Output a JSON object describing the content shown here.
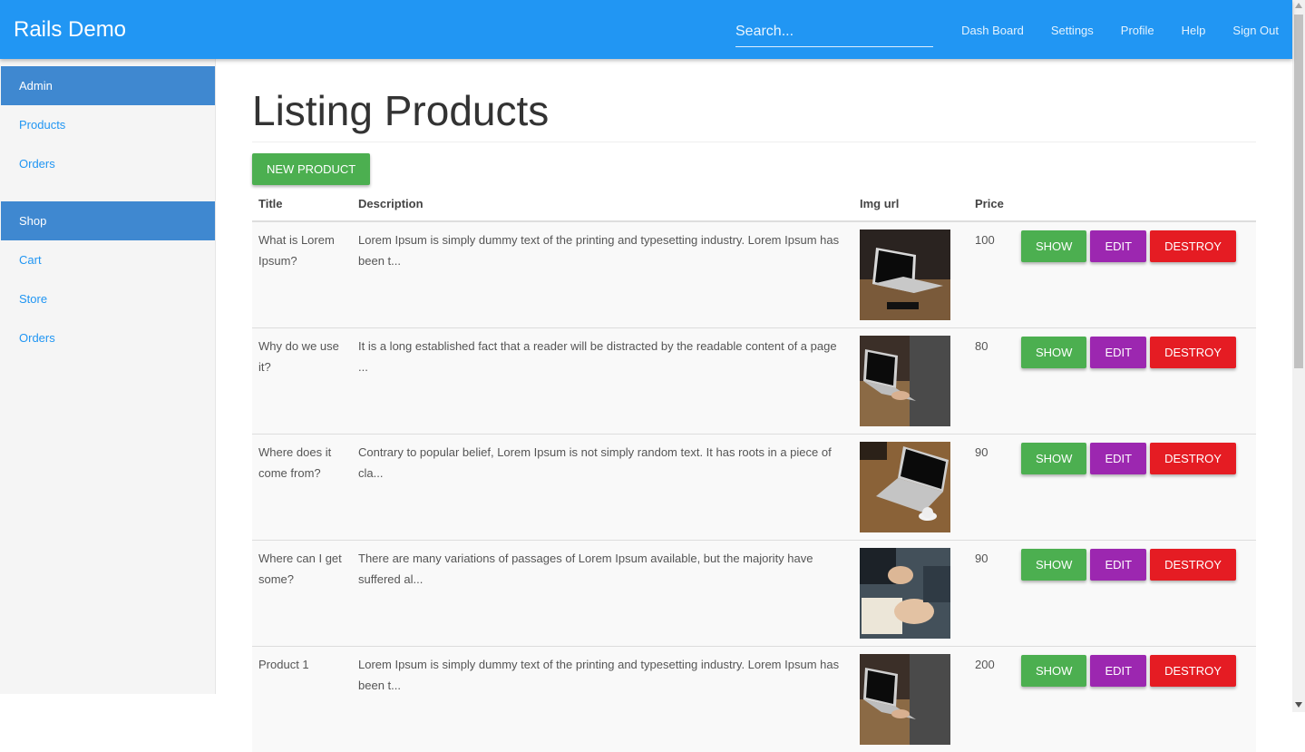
{
  "app": {
    "brand": "Rails Demo"
  },
  "search": {
    "placeholder": "Search..."
  },
  "nav": [
    "Dash Board",
    "Settings",
    "Profile",
    "Help",
    "Sign Out"
  ],
  "sidebar": {
    "admin_heading": "Admin",
    "admin_items": [
      "Products",
      "Orders"
    ],
    "shop_heading": "Shop",
    "shop_items": [
      "Cart",
      "Store",
      "Orders"
    ]
  },
  "page": {
    "title": "Listing Products",
    "new_button": "NEW PRODUCT"
  },
  "table": {
    "headers": [
      "Title",
      "Description",
      "Img url",
      "Price"
    ],
    "rows": [
      {
        "title": "What is Lorem Ipsum?",
        "description": "Lorem Ipsum is simply dummy text of the printing and typesetting industry. Lorem Ipsum has been t...",
        "price": "100",
        "image": "laptop-on-table"
      },
      {
        "title": "Why do we use it?",
        "description": "It is a long established fact that a reader will be distracted by the readable content of a page ...",
        "price": "80",
        "image": "person-typing-laptop"
      },
      {
        "title": "Where does it come from?",
        "description": "Contrary to popular belief, Lorem Ipsum is not simply random text. It has roots in a piece of cla...",
        "price": "90",
        "image": "laptop-with-coffee"
      },
      {
        "title": "Where can I get some?",
        "description": "There are many variations of passages of Lorem Ipsum available, but the majority have suffered al...",
        "price": "90",
        "image": "hands-writing-notebook"
      },
      {
        "title": "Product 1",
        "description": "Lorem Ipsum is simply dummy text of the printing and typesetting industry. Lorem Ipsum has been t...",
        "price": "200",
        "image": "person-typing-laptop"
      }
    ],
    "actions": {
      "show": "SHOW",
      "edit": "EDIT",
      "destroy": "DESTROY"
    }
  },
  "colors": {
    "primary": "#2196f3",
    "sidebar_heading": "#3f88d0",
    "show": "#4caf50",
    "edit": "#9c27b0",
    "destroy": "#e51c23"
  }
}
